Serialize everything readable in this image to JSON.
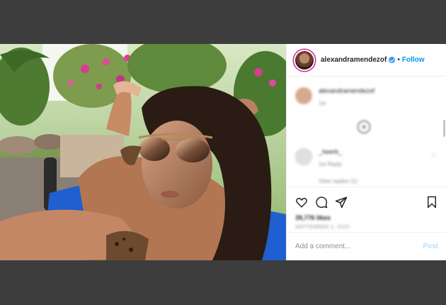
{
  "post": {
    "username": "alexandramendezof",
    "separator": "•",
    "follow_label": "Follow"
  },
  "comments": {
    "caption_user": "alexandramendezof",
    "caption_meta": "1w",
    "comment_user": "_heerb_",
    "comment_meta": "1w   Reply",
    "reply_preview": "View replies (1)"
  },
  "actions": {
    "likes": "39,776 likes",
    "date": "SEPTEMBER 2, 2020"
  },
  "add_comment": {
    "placeholder": "Add a comment...",
    "post_label": "Post"
  },
  "icons": [
    "verified-badge-icon",
    "heart-icon",
    "comment-icon",
    "share-icon",
    "bookmark-icon",
    "plus-circle-icon"
  ],
  "colors": {
    "accent": "#0095f6",
    "post_disabled": "#b2dffc",
    "backdrop": "#3d3d3d"
  }
}
